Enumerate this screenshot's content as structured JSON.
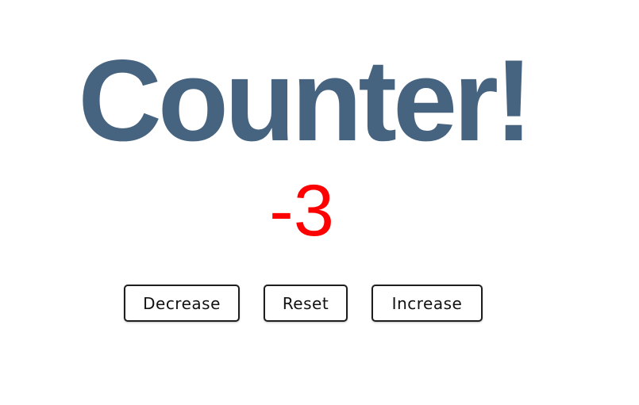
{
  "title": "Counter!",
  "counter": {
    "value": "-3",
    "color": "#ff0000"
  },
  "controls": {
    "decrease_label": "Decrease",
    "reset_label": "Reset",
    "increase_label": "Increase"
  },
  "colors": {
    "title": "#46637f",
    "button_border": "#1e1e1e",
    "background": "#ffffff"
  }
}
